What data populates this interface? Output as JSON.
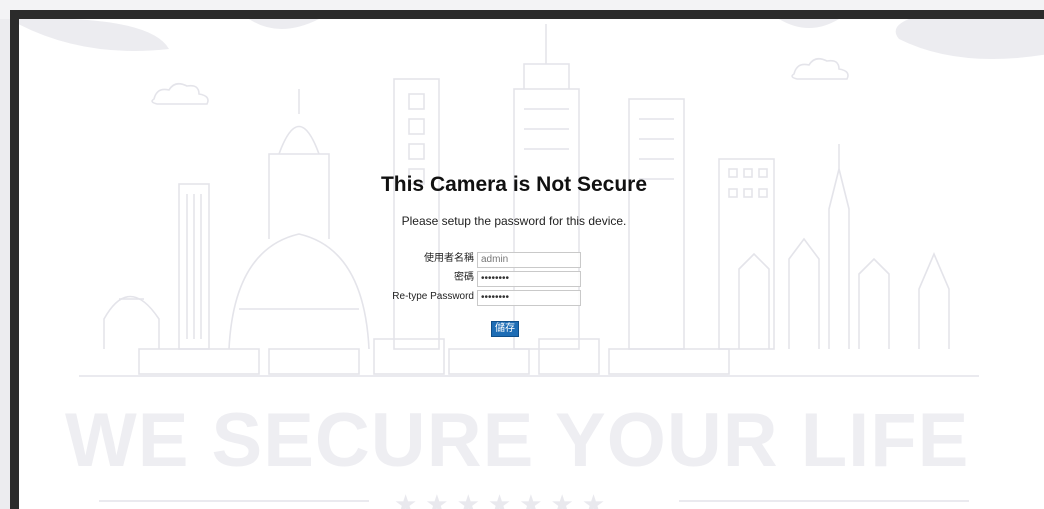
{
  "page": {
    "title": "This Camera is Not Secure",
    "subtitle": "Please setup the password for this device."
  },
  "form": {
    "username_label": "使用者名稱",
    "username_value": "admin",
    "password_label": "密碼",
    "password_value": "••••••••",
    "retype_label": "Re-type Password",
    "retype_value": "••••••••",
    "save_label": "儲存"
  },
  "background": {
    "watermark": "WE SECURE YOUR LIFE",
    "stars": "★★★★★★★",
    "skyline_icon": "city-skyline-icon",
    "cloud_icon": "cloud-icon"
  },
  "colors": {
    "accent": "#1e6db5",
    "frame": "#2b2b2b",
    "watermark": "#eeeef2",
    "skyline_line": "#e4e4ea"
  }
}
